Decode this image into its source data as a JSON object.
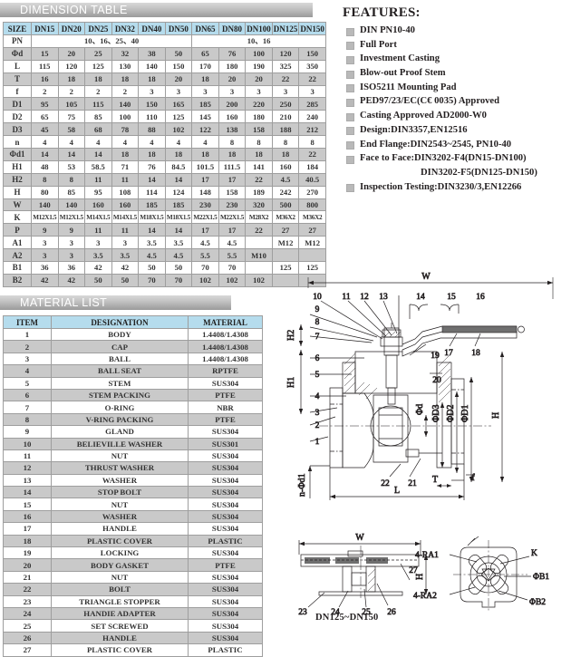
{
  "sections": {
    "dimension_title": "DIMENSION TABLE",
    "material_title": "MATERIAL LIST",
    "features_title": "FEATURES:"
  },
  "dimension_table": {
    "columns": [
      "SIZE",
      "DN15",
      "DN20",
      "DN25",
      "DN32",
      "DN40",
      "DN50",
      "DN65",
      "DN80",
      "DN100",
      "DN125",
      "DN150"
    ],
    "pn_row": {
      "label": "PN",
      "left_value": "10、16、25、40",
      "right_value": "10、16"
    },
    "rows": [
      {
        "label": "Φd",
        "values": [
          "15",
          "20",
          "25",
          "32",
          "38",
          "50",
          "65",
          "76",
          "100",
          "120",
          "150"
        ]
      },
      {
        "label": "L",
        "values": [
          "115",
          "120",
          "125",
          "130",
          "140",
          "150",
          "170",
          "180",
          "190",
          "325",
          "350"
        ]
      },
      {
        "label": "T",
        "values": [
          "16",
          "18",
          "18",
          "18",
          "18",
          "20",
          "18",
          "20",
          "20",
          "22",
          "22"
        ]
      },
      {
        "label": "f",
        "values": [
          "2",
          "2",
          "2",
          "2",
          "3",
          "3",
          "3",
          "3",
          "3",
          "3",
          "3"
        ]
      },
      {
        "label": "D1",
        "values": [
          "95",
          "105",
          "115",
          "140",
          "150",
          "165",
          "185",
          "200",
          "220",
          "250",
          "285"
        ]
      },
      {
        "label": "D2",
        "values": [
          "65",
          "75",
          "85",
          "100",
          "110",
          "125",
          "145",
          "160",
          "180",
          "210",
          "240"
        ]
      },
      {
        "label": "D3",
        "values": [
          "45",
          "58",
          "68",
          "78",
          "88",
          "102",
          "122",
          "138",
          "158",
          "188",
          "212"
        ]
      },
      {
        "label": "n",
        "values": [
          "4",
          "4",
          "4",
          "4",
          "4",
          "4",
          "4",
          "8",
          "8",
          "8",
          "8"
        ]
      },
      {
        "label": "Φd1",
        "values": [
          "14",
          "14",
          "14",
          "18",
          "18",
          "18",
          "18",
          "18",
          "18",
          "18",
          "22"
        ]
      },
      {
        "label": "H1",
        "values": [
          "48",
          "53",
          "58.5",
          "71",
          "76",
          "84.5",
          "101.5",
          "111.5",
          "141",
          "160",
          "184"
        ]
      },
      {
        "label": "H2",
        "values": [
          "8",
          "8",
          "11",
          "11",
          "14",
          "14",
          "17",
          "17",
          "22",
          "4.5",
          "40.5"
        ]
      },
      {
        "label": "H",
        "values": [
          "80",
          "85",
          "95",
          "108",
          "114",
          "124",
          "148",
          "158",
          "189",
          "242",
          "270"
        ]
      },
      {
        "label": "W",
        "values": [
          "140",
          "140",
          "160",
          "160",
          "185",
          "185",
          "230",
          "230",
          "320",
          "500",
          "800"
        ]
      },
      {
        "label": "K",
        "values": [
          "M12X1.5",
          "M12X1.5",
          "M14X1.5",
          "M14X1.5",
          "M18X1.5",
          "M18X1.5",
          "M22X1.5",
          "M22X1.5",
          "M28X2",
          "M36X2",
          "M36X2"
        ],
        "small": true
      },
      {
        "label": "P",
        "values": [
          "9",
          "9",
          "11",
          "11",
          "14",
          "14",
          "17",
          "17",
          "22",
          "27",
          "27"
        ]
      },
      {
        "label": "A1",
        "values": [
          "3",
          "3",
          "3",
          "3",
          "3.5",
          "3.5",
          "4.5",
          "4.5",
          "",
          "M12",
          "M12"
        ]
      },
      {
        "label": "A2",
        "values": [
          "3",
          "3",
          "3.5",
          "3.5",
          "4.5",
          "4.5",
          "5.5",
          "5.5",
          "M10",
          "",
          ""
        ]
      },
      {
        "label": "B1",
        "values": [
          "36",
          "36",
          "42",
          "42",
          "50",
          "50",
          "70",
          "70",
          "",
          "125",
          "125"
        ]
      },
      {
        "label": "B2",
        "values": [
          "42",
          "42",
          "50",
          "50",
          "70",
          "70",
          "102",
          "102",
          "102",
          "",
          ""
        ]
      }
    ]
  },
  "material_list": {
    "columns": [
      "ITEM",
      "DESIGNATION",
      "MATERIAL"
    ],
    "rows": [
      {
        "item": "1",
        "designation": "BODY",
        "material": "1.4408/1.4308"
      },
      {
        "item": "2",
        "designation": "CAP",
        "material": "1.4408/1.4308"
      },
      {
        "item": "3",
        "designation": "BALL",
        "material": "1.4408/1.4308"
      },
      {
        "item": "4",
        "designation": "BALL SEAT",
        "material": "RPTFE"
      },
      {
        "item": "5",
        "designation": "STEM",
        "material": "SUS304"
      },
      {
        "item": "6",
        "designation": "STEM PACKING",
        "material": "PTFE"
      },
      {
        "item": "7",
        "designation": "O-RING",
        "material": "NBR"
      },
      {
        "item": "8",
        "designation": "V-RING PACKING",
        "material": "PTFE"
      },
      {
        "item": "9",
        "designation": "GLAND",
        "material": "SUS304"
      },
      {
        "item": "10",
        "designation": "BELIEVILLE WASHER",
        "material": "SUS301"
      },
      {
        "item": "11",
        "designation": "NUT",
        "material": "SUS304"
      },
      {
        "item": "12",
        "designation": "THRUST WASHER",
        "material": "SUS304"
      },
      {
        "item": "13",
        "designation": "WASHER",
        "material": "SUS304"
      },
      {
        "item": "14",
        "designation": "STOP BOLT",
        "material": "SUS304"
      },
      {
        "item": "15",
        "designation": "NUT",
        "material": "SUS304"
      },
      {
        "item": "16",
        "designation": "WASHER",
        "material": "SUS304"
      },
      {
        "item": "17",
        "designation": "HANDLE",
        "material": "SUS304"
      },
      {
        "item": "18",
        "designation": "PLASTIC COVER",
        "material": "PLASTIC"
      },
      {
        "item": "19",
        "designation": "LOCKING",
        "material": "SUS304"
      },
      {
        "item": "20",
        "designation": "BODY GASKET",
        "material": "PTFE"
      },
      {
        "item": "21",
        "designation": "NUT",
        "material": "SUS304"
      },
      {
        "item": "22",
        "designation": "BOLT",
        "material": "SUS304"
      },
      {
        "item": "23",
        "designation": "TRIANGLE STOPPER",
        "material": "SUS304"
      },
      {
        "item": "24",
        "designation": "HANDIE ADAPTER",
        "material": "SUS304"
      },
      {
        "item": "25",
        "designation": "SET SCREWED",
        "material": "SUS304"
      },
      {
        "item": "26",
        "designation": "HANDLE",
        "material": "SUS304"
      },
      {
        "item": "27",
        "designation": "PLASTIC COVER",
        "material": "PLASTIC"
      }
    ]
  },
  "features": {
    "items": [
      "DIN PN10-40",
      "Full  Port",
      "Investment Casting",
      "Blow-out Proof Stem",
      "ISO5211 Mounting Pad",
      "PED97/23/EC(C€ 0035) Approved",
      "Casting Approved AD2000-W0",
      "Design:DIN3357,EN12516",
      "End Flange:DIN2543~2545, PN10-40",
      "Face to Face:DIN3202-F4(DN15-DN100)"
    ],
    "continuation": "DIN3202-F5(DN125-DN150)",
    "last_item": "Inspection Testing:DIN3230/3,EN12266"
  },
  "drawing": {
    "caption": "DN125~DN150",
    "balloons": [
      "1",
      "2",
      "3",
      "4",
      "5",
      "6",
      "7",
      "8",
      "9",
      "10",
      "11",
      "12",
      "13",
      "14",
      "15",
      "16",
      "17",
      "18",
      "19",
      "20",
      "21",
      "22",
      "23",
      "24",
      "25",
      "26",
      "27"
    ],
    "dimension_labels": [
      "W",
      "H",
      "H1",
      "H2",
      "L",
      "T",
      "f",
      "Φd",
      "ΦD1",
      "ΦD2",
      "ΦD3",
      "n-Φd1"
    ],
    "flange_detail_labels": [
      "4-RA1",
      "4-RA2",
      "K",
      "ΦB1",
      "ΦB2"
    ]
  },
  "colors": {
    "header_blue": "#b5dced",
    "row_gray": "#c9c9c9",
    "bar_gray": "#b0b0b0",
    "line": "#9e9e9e",
    "text": "#231f20"
  }
}
